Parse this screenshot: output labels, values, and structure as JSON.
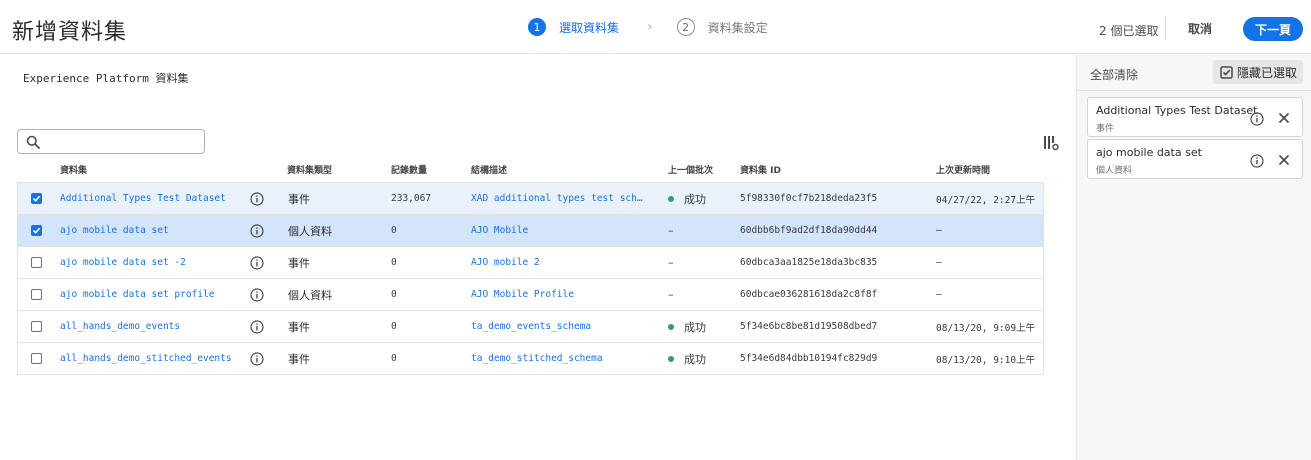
{
  "header": {
    "title": "新增資料集",
    "steps": [
      {
        "num": "1",
        "label": "選取資料集"
      },
      {
        "num": "2",
        "label": "資料集設定"
      }
    ],
    "selected_count": "2 個已選取",
    "cancel_label": "取消",
    "next_label": "下一頁"
  },
  "main": {
    "section_title": "Experience Platform 資料集",
    "search": {
      "value": "",
      "placeholder": ""
    },
    "columns": [
      "資料集",
      "資料集類型",
      "記錄數量",
      "結構描述",
      "上一個批次",
      "資料集 ID",
      "上次更新時間"
    ],
    "rows": [
      {
        "checked": true,
        "name": "Additional Types Test Dataset",
        "type": "事件",
        "count": "233,067",
        "schema": "XAD additional types test sch…",
        "batch": "成功",
        "batch_ok": true,
        "id": "5f98330f0cf7b218deda23f5",
        "updated": "04/27/22, 2:27上午"
      },
      {
        "checked": true,
        "name": "ajo mobile data set",
        "type": "個人資料",
        "count": "0",
        "schema": "AJO Mobile",
        "batch": "–",
        "batch_ok": false,
        "id": "60dbb6bf9ad2df18da90dd44",
        "updated": "–"
      },
      {
        "checked": false,
        "name": "ajo mobile data set -2",
        "type": "事件",
        "count": "0",
        "schema": "AJO mobile 2",
        "batch": "–",
        "batch_ok": false,
        "id": "60dbca3aa1825e18da3bc835",
        "updated": "–"
      },
      {
        "checked": false,
        "name": "ajo mobile data set profile",
        "type": "個人資料",
        "count": "0",
        "schema": "AJO Mobile Profile",
        "batch": "–",
        "batch_ok": false,
        "id": "60dbcae036281618da2c8f8f",
        "updated": "–"
      },
      {
        "checked": false,
        "name": "all_hands_demo_events",
        "type": "事件",
        "count": "0",
        "schema": "ta_demo_events_schema",
        "batch": "成功",
        "batch_ok": true,
        "id": "5f34e6bc8be81d19508dbed7",
        "updated": "08/13/20, 9:09上午"
      },
      {
        "checked": false,
        "name": "all_hands_demo_stitched_events",
        "type": "事件",
        "count": "0",
        "schema": "ta_demo_stitched_schema",
        "batch": "成功",
        "batch_ok": true,
        "id": "5f34e6d84dbb10194fc829d9",
        "updated": "08/13/20, 9:10上午"
      }
    ]
  },
  "rail": {
    "clear_all_label": "全部清除",
    "hide_selected_label": "隱藏已選取",
    "selected": [
      {
        "name": "Additional Types Test Dataset",
        "type": "事件"
      },
      {
        "name": "ajo mobile data set",
        "type": "個人資料"
      }
    ]
  },
  "colors": {
    "accent": "#1473e6",
    "success": "#2d9d78",
    "row_selected": "#d3e4fb"
  }
}
